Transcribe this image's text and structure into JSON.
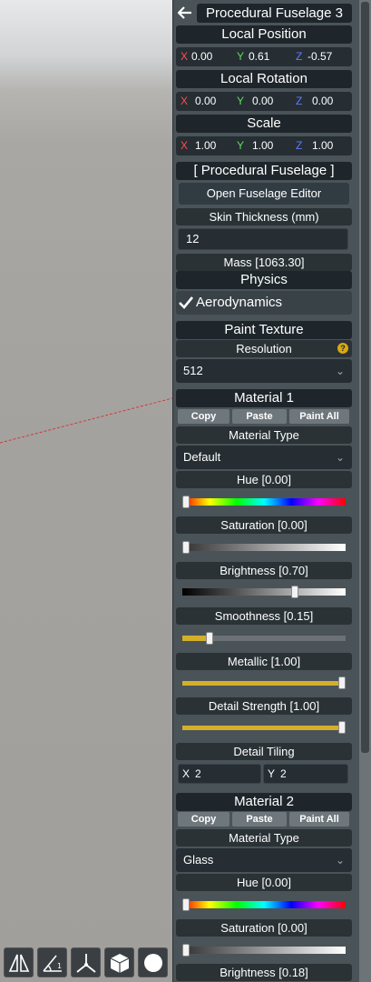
{
  "panel": {
    "title": "Procedural Fuselage 3",
    "local_position": {
      "label": "Local Position",
      "x": "0.00",
      "y": "0.61",
      "z": "-0.57"
    },
    "local_rotation": {
      "label": "Local Rotation",
      "x": "0.00",
      "y": "0.00",
      "z": "0.00"
    },
    "scale": {
      "label": "Scale",
      "x": "1.00",
      "y": "1.00",
      "z": "1.00"
    },
    "axis": {
      "x": "X",
      "y": "Y",
      "z": "Z"
    },
    "fuselage_section": "[ Procedural Fuselage ]",
    "open_editor": "Open Fuselage Editor",
    "skin_thickness_label": "Skin Thickness (mm)",
    "skin_thickness_value": "12",
    "mass": "Mass [1063.30]",
    "physics": "Physics",
    "aerodynamics": "Aerodynamics",
    "aerodynamics_checked": true,
    "paint_texture": "Paint Texture",
    "resolution_label": "Resolution",
    "resolution_value": "512",
    "help_icon": "?",
    "buttons": {
      "copy": "Copy",
      "paste": "Paste",
      "paint_all": "Paint All"
    },
    "material1": {
      "title": "Material 1",
      "type_label": "Material Type",
      "type_value": "Default",
      "hue": "Hue [0.00]",
      "hue_value": 0.0,
      "saturation": "Saturation [0.00]",
      "saturation_value": 0.0,
      "brightness": "Brightness [0.70]",
      "brightness_value": 0.7,
      "smoothness": "Smoothness [0.15]",
      "smoothness_value": 0.15,
      "metallic": "Metallic [1.00]",
      "metallic_value": 1.0,
      "detail_strength": "Detail Strength [1.00]",
      "detail_strength_value": 1.0,
      "detail_tiling": "Detail Tiling",
      "tiling_x": "2",
      "tiling_y": "2"
    },
    "material2": {
      "title": "Material 2",
      "type_label": "Material Type",
      "type_value": "Glass",
      "hue": "Hue [0.00]",
      "hue_value": 0.0,
      "saturation": "Saturation [0.00]",
      "saturation_value": 0.0,
      "brightness": "Brightness [0.18]"
    }
  },
  "colors": {
    "panel_bg": "#4a5358",
    "header_bg": "#1e262b",
    "gold": "#d4b02a",
    "x_axis": "#ff4d4d",
    "y_axis": "#5fdc5f",
    "z_axis": "#5e7cff"
  },
  "icons": [
    "back-arrow-icon",
    "checkmark-icon",
    "chevron-down-icon",
    "help-icon",
    "symmetry-icon",
    "angle-snap-icon",
    "transform-axes-icon",
    "cube-icon",
    "sphere-icon"
  ]
}
